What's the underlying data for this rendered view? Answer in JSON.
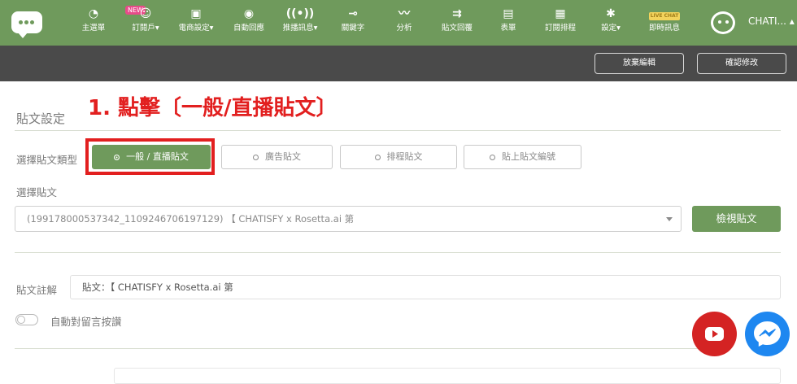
{
  "nav": {
    "items": [
      {
        "label": "主選單",
        "icon": "gauge-icon"
      },
      {
        "label": "訂閱戶▾",
        "icon": "users-icon"
      },
      {
        "label": "電商設定▾",
        "icon": "box-icon"
      },
      {
        "label": "自動回應",
        "icon": "robot-icon"
      },
      {
        "label": "推播訊息▾",
        "icon": "broadcast-icon"
      },
      {
        "label": "關鍵字",
        "icon": "key-icon"
      },
      {
        "label": "分析",
        "icon": "chart-icon"
      },
      {
        "label": "貼文回覆",
        "icon": "reply-icon"
      },
      {
        "label": "表單",
        "icon": "form-icon"
      },
      {
        "label": "訂閱排程",
        "icon": "calendar-icon"
      },
      {
        "label": "設定▾",
        "icon": "gear-icon"
      },
      {
        "label": "即時訊息",
        "icon": "live-chat-icon"
      }
    ],
    "new_badge": "NEW",
    "live_badge": "LIVE CHAT",
    "user_name": "CHATI... ▴"
  },
  "subbar": {
    "discard_label": "放棄編輯",
    "confirm_label": "確認修改"
  },
  "annotation": "1. 點擊〔一般/直播貼文〕",
  "section_title": "貼文設定",
  "post_type": {
    "label": "選擇貼文類型",
    "options": [
      "一般 / 直播貼文",
      "廣告貼文",
      "排程貼文",
      "貼上貼文編號"
    ],
    "selected": "一般 / 直播貼文"
  },
  "post_select": {
    "label": "選擇貼文",
    "value": "(199178000537342_1109246706197129) 【 CHATISFY x Rosetta.ai 第",
    "view_button": "檢視貼文"
  },
  "note": {
    "label": "貼文註解",
    "value": "貼文：【 CHATISFY x Rosetta.ai 第"
  },
  "auto_like": {
    "label": "自動對留言按讚",
    "enabled": false
  },
  "colors": {
    "brand_green": "#6f9a5c",
    "subbar": "#4a4a4a",
    "annotation_red": "#e21f1f",
    "youtube_red": "#d42323",
    "messenger_blue": "#1e87f0"
  }
}
